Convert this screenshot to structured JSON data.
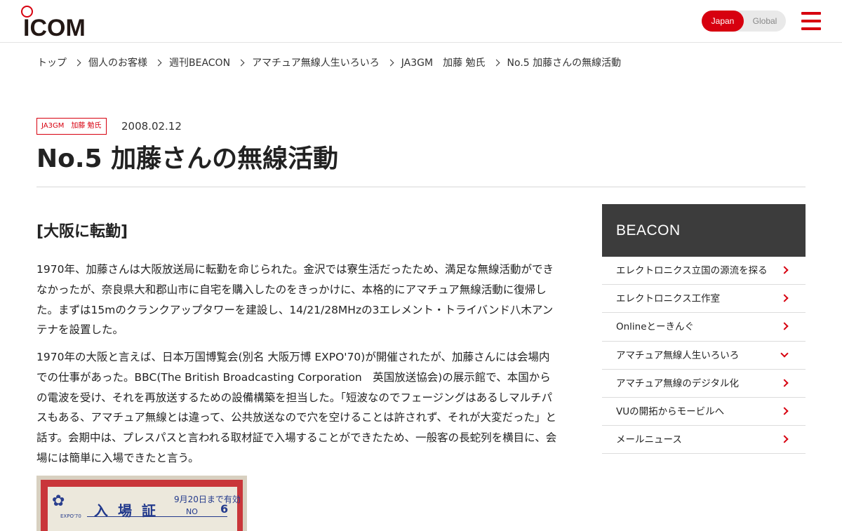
{
  "header": {
    "logo_text": "ICOM",
    "region": {
      "japan": "Japan",
      "global": "Global",
      "selected": "Japan"
    },
    "accent_color": "#d7000f",
    "menu_icon": "hamburger-icon"
  },
  "breadcrumb": [
    "トップ",
    "個人のお客様",
    "週刊BEACON",
    "アマチュア無線人生いろいろ",
    "JA3GM　加藤 勉氏",
    "No.5 加藤さんの無線活動"
  ],
  "article": {
    "tag": "JA3GM　加藤 勉氏",
    "date": "2008.02.12",
    "title": "No.5 加藤さんの無線活動",
    "section_heading": "[大阪に転勤]",
    "paragraphs": [
      "1970年、加藤さんは大阪放送局に転勤を命じられた。金沢では寮生活だったため、満足な無線活動ができなかったが、奈良県大和郡山市に自宅を購入したのをきっかけに、本格的にアマチュア無線活動に復帰した。まずは15mのクランクアップタワーを建設し、14/21/28MHzの3エレメント・トライバンド八木アンテナを設置した。",
      "1970年の大阪と言えば、日本万国博覧会(別名 大阪万博 EXPO'70)が開催されたが、加藤さんには会場内での仕事があった。BBC(The British Broadcasting Corporation　英国放送協会)の展示館で、本国からの電波を受け、それを再放送するための設備構築を担当した。「短波なのでフェージングはあるしマルチパスもある、アマチュア無線とは違って、公共放送なので穴を空けることは許されず、それが大変だった」と話す。会期中は、プレスパスと言われる取材証で入場することができたため、一般客の長蛇列を横目に、会場には簡単に入場できたと言う。"
    ],
    "ticket_image": {
      "title": "入場証",
      "valid": "9月20日まで有効",
      "no_label": "NO",
      "number": "6",
      "emblem_label": "EXPO'70"
    }
  },
  "sidebar": {
    "title": "BEACON",
    "items": [
      {
        "label": "エレクトロニクス立国の源流を探る",
        "icon": "chevron-right-icon"
      },
      {
        "label": "エレクトロニクス工作室",
        "icon": "chevron-right-icon"
      },
      {
        "label": "Onlineとーきんぐ",
        "icon": "chevron-right-icon"
      },
      {
        "label": "アマチュア無線人生いろいろ",
        "icon": "chevron-down-icon"
      },
      {
        "label": "アマチュア無線のデジタル化",
        "icon": "chevron-right-icon"
      },
      {
        "label": "VUの開拓からモービルへ",
        "icon": "chevron-right-icon"
      },
      {
        "label": "メールニュース",
        "icon": "chevron-right-icon"
      }
    ]
  }
}
